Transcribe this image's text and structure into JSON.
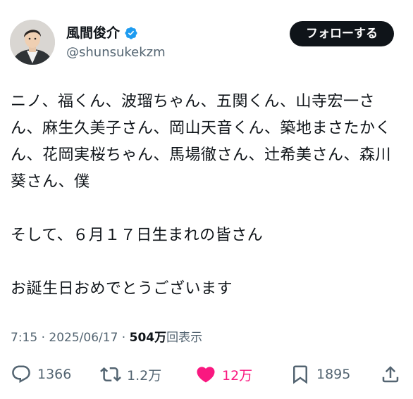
{
  "author": {
    "display_name": "風間俊介",
    "handle": "@shunsukekzm",
    "verified_icon": "verified-badge-icon",
    "avatar_icon": "avatar-photo"
  },
  "follow_button": {
    "label": "フォローする"
  },
  "tweet": {
    "text": "ニノ、福くん、波瑠ちゃん、五関くん、山寺宏一さん、麻生久美子さん、岡山天音くん、築地まさたかくん、花岡実桜ちゃん、馬場徹さん、辻希美さん、森川葵さん、僕\n\nそして、６月１７日生まれの皆さん\n\nお誕生日おめでとうございます"
  },
  "meta": {
    "time": "7:15",
    "separator1": " · ",
    "date": "2025/06/17",
    "separator2": " · ",
    "views_count": "504万",
    "views_label": "回表示"
  },
  "actions": {
    "reply_count": "1366",
    "repost_count": "1.2万",
    "like_count": "12万",
    "bookmark_count": "1895"
  },
  "colors": {
    "text": "#0f1419",
    "secondary": "#536471",
    "like": "#f91880",
    "verified": "#1d9bf0",
    "button_bg": "#0f1419"
  }
}
